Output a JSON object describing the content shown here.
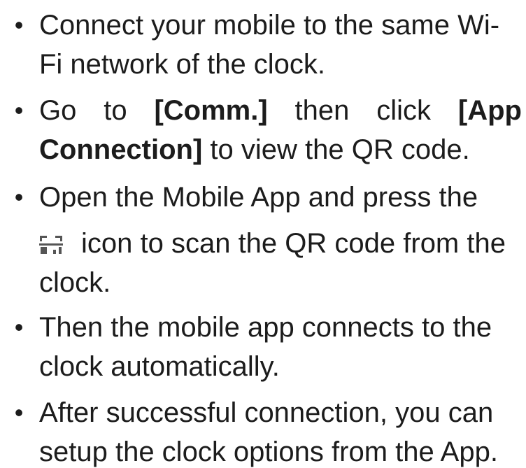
{
  "bullet_glyph": "•",
  "items": [
    {
      "line1": "Connect your mobile to the same Wi-",
      "line2": "Fi network of the clock."
    },
    {
      "go_to": "Go",
      "to_word": "to",
      "comm": "[Comm.]",
      "then_word": "then",
      "click_word": "click",
      "app_bold": "[App",
      "connection_bold": "Connection]",
      "line2_rest": " to view the QR code."
    },
    {
      "line1": "Open the Mobile App and press the",
      "icon": "qr-scan-icon",
      "line2": "icon to scan the QR code from the",
      "line3": "clock."
    },
    {
      "line1": "Then the mobile app connects to the",
      "line2": "clock automatically."
    },
    {
      "line1": "After successful connection, you can",
      "line2": "setup the clock options from the App."
    }
  ]
}
